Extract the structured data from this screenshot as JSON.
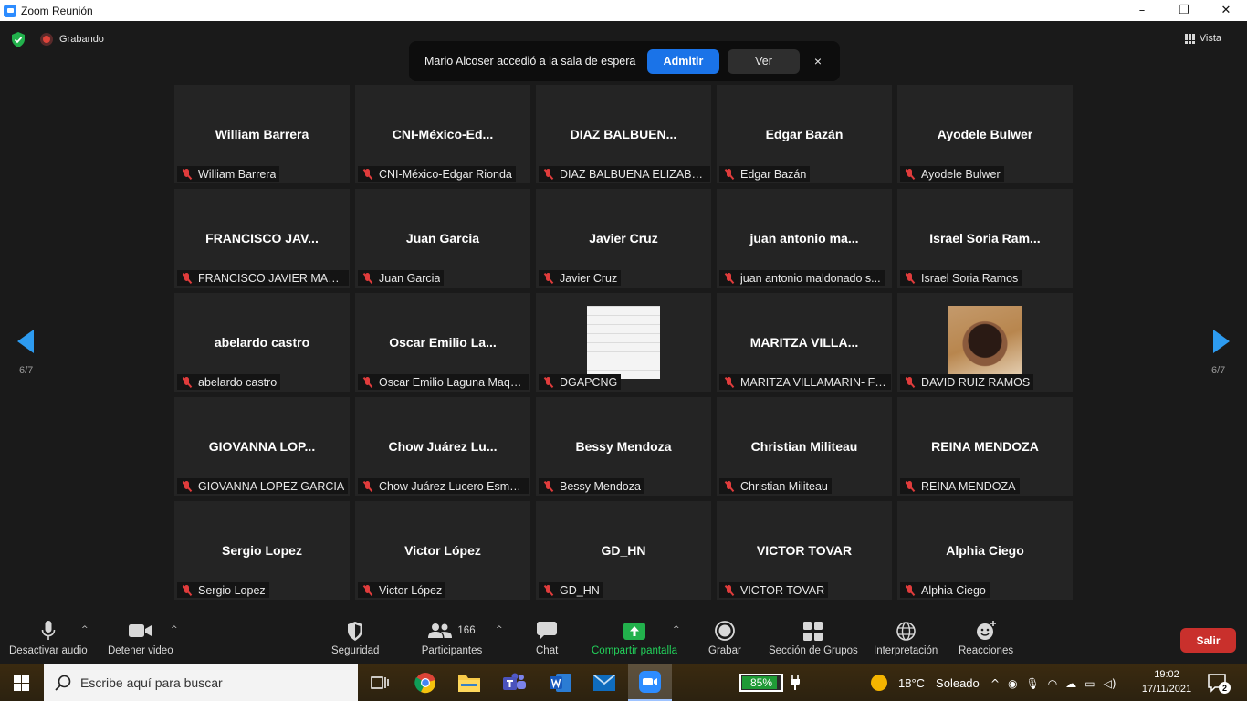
{
  "window": {
    "title": "Zoom Reunión"
  },
  "topbar": {
    "recording_label": "Grabando",
    "view_label": "Vista"
  },
  "notification": {
    "text": "Mario Alcoser accedió a la sala de espera",
    "admit_label": "Admitir",
    "view_label": "Ver",
    "close_label": "×"
  },
  "gallery": {
    "page_left": "6/7",
    "page_right": "6/7",
    "tiles": [
      {
        "name": "William Barrera",
        "label": "William Barrera"
      },
      {
        "name": "CNI-México-Ed...",
        "label": "CNI-México-Edgar Rionda"
      },
      {
        "name": "DIAZ BALBUEN...",
        "label": "DIAZ BALBUENA ELIZABETH"
      },
      {
        "name": "Edgar Bazán",
        "label": "Edgar Bazán"
      },
      {
        "name": "Ayodele Bulwer",
        "label": "Ayodele Bulwer"
      },
      {
        "name": "FRANCISCO JAV...",
        "label": "FRANCISCO JAVIER MARTI..."
      },
      {
        "name": "Juan Garcia",
        "label": "Juan Garcia"
      },
      {
        "name": "Javier Cruz",
        "label": "Javier Cruz"
      },
      {
        "name": "juan antonio ma...",
        "label": "juan antonio maldonado s..."
      },
      {
        "name": "Israel Soria Ram...",
        "label": "Israel Soria Ramos"
      },
      {
        "name": "abelardo castro",
        "label": "abelardo castro"
      },
      {
        "name": "Oscar Emilio La...",
        "label": "Oscar Emilio Laguna Maqu..."
      },
      {
        "name": "",
        "label": "DGAPCNG",
        "image": "document"
      },
      {
        "name": "MARITZA VILLA...",
        "label": "MARITZA VILLAMARIN- FG..."
      },
      {
        "name": "",
        "label": "DAVID RUIZ RAMOS",
        "image": "photo"
      },
      {
        "name": "GIOVANNA LOP...",
        "label": "GIOVANNA LOPEZ GARCIA"
      },
      {
        "name": "Chow Juárez Lu...",
        "label": "Chow Juárez Lucero Esmer..."
      },
      {
        "name": "Bessy Mendoza",
        "label": "Bessy Mendoza"
      },
      {
        "name": "Christian Militeau",
        "label": "Christian Militeau"
      },
      {
        "name": "REINA MENDOZA",
        "label": "REINA MENDOZA"
      },
      {
        "name": "Sergio Lopez",
        "label": "Sergio Lopez"
      },
      {
        "name": "Victor López",
        "label": "Victor López"
      },
      {
        "name": "GD_HN",
        "label": "GD_HN"
      },
      {
        "name": "VICTOR TOVAR",
        "label": "VICTOR TOVAR"
      },
      {
        "name": "Alphia Ciego",
        "label": "Alphia Ciego"
      }
    ]
  },
  "toolbar": {
    "mute_label": "Desactivar audio",
    "video_label": "Detener video",
    "security_label": "Seguridad",
    "participants_label": "Participantes",
    "participants_count": "166",
    "chat_label": "Chat",
    "share_label": "Compartir pantalla",
    "record_label": "Grabar",
    "breakout_label": "Sección de Grupos",
    "interpretation_label": "Interpretación",
    "reactions_label": "Reacciones",
    "leave_label": "Salir"
  },
  "taskbar": {
    "search_placeholder": "Escribe aquí para buscar",
    "battery": "85%",
    "weather_temp": "18°C",
    "weather_desc": "Soleado",
    "time": "19:02",
    "date": "17/11/2021",
    "notification_count": "2"
  },
  "colors": {
    "accent_blue": "#1a73e8",
    "leave_red": "#c9302c",
    "share_green": "#22b14c",
    "mic_muted_red": "#e03c3c",
    "arrow_blue": "#2d9bf0"
  }
}
